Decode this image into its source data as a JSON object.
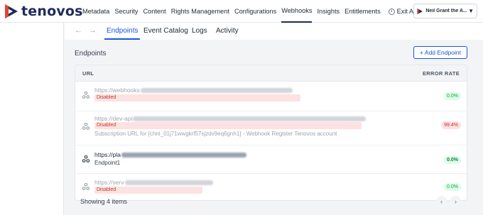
{
  "brand": {
    "name": "tenovos",
    "accent": "#1e2a5a"
  },
  "nav": {
    "links": [
      "Metadata",
      "Security",
      "Content",
      "Rights Management",
      "Configurations",
      "Webhooks",
      "Insights",
      "Entitlements"
    ],
    "active": "Webhooks",
    "exit_admin": "Exit Admin",
    "user": "Neil Grant the A..."
  },
  "tabs": {
    "items": [
      "Endpoints",
      "Event Catalog",
      "Logs",
      "Activity"
    ],
    "active": "Endpoints"
  },
  "section": {
    "title": "Endpoints",
    "add_button": "+ Add Endpoint"
  },
  "table": {
    "headers": {
      "url": "URL",
      "error_rate": "ERROR RATE"
    },
    "rows": [
      {
        "url": "https://webhooks",
        "status": "Disabled",
        "description": "",
        "error_rate": "0.0%",
        "state": "disabled"
      },
      {
        "url": "https://dev-api",
        "status": "Disabled",
        "description": "Subscription URL for [chnl_01j71wwgkrf57sjzdv9eq6gnh1] - Webhook Register Tenovos account",
        "error_rate": "99.4%",
        "state": "disabled"
      },
      {
        "url": "https://pla",
        "status": "",
        "description": "Endpoint1",
        "error_rate": "0.0%",
        "state": "enabled"
      },
      {
        "url": "https://serv",
        "status": "Disabled",
        "description": "",
        "error_rate": "0.0%",
        "state": "disabled"
      }
    ]
  },
  "footer": {
    "count": "Showing 4 items"
  },
  "icons": {
    "back": "arrow-left-icon",
    "forward": "arrow-right-icon",
    "webhook": "webhook-icon",
    "prev": "chevron-left-icon",
    "next": "chevron-right-icon"
  }
}
